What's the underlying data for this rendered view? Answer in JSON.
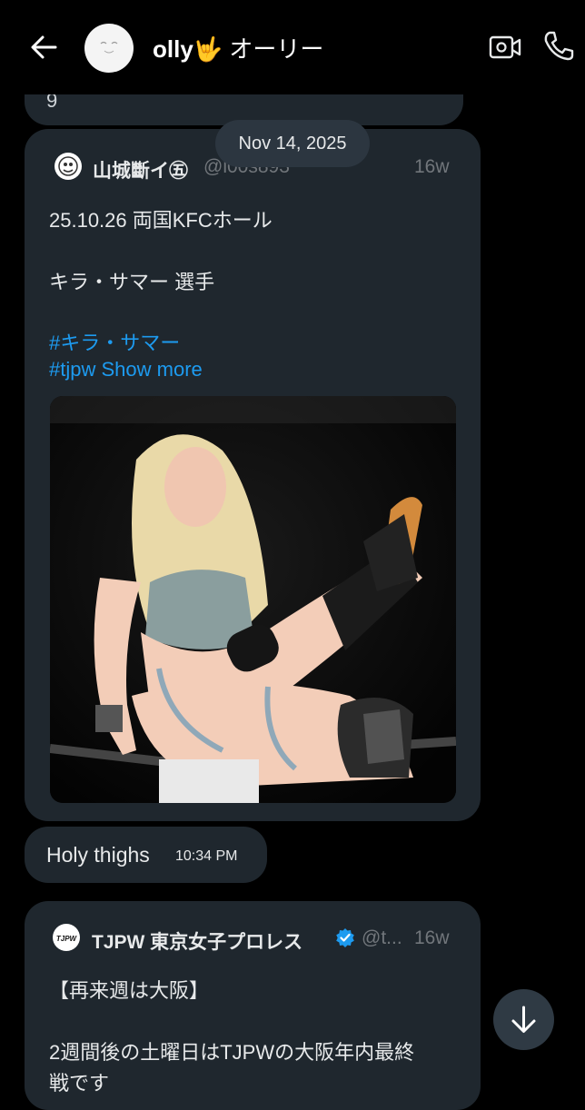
{
  "header": {
    "name": "olly",
    "emoji": "🤟",
    "name_jp": "オーリー"
  },
  "previous_message_fragment": "9",
  "date_separator": "Nov 14, 2025",
  "tweet1": {
    "author": "山城斷イ㊄",
    "handle": "@l00s893",
    "age": "16w",
    "line1": "25.10.26 両国KFCホール",
    "line2": "キラ・サマー 選手",
    "hashtag1": "#キラ・サマー",
    "hashtag2": "#tjpw",
    "show_more": "Show more"
  },
  "message": {
    "text": "Holy thighs",
    "time": "10:34 PM"
  },
  "tweet2": {
    "avatar_text": "TJPW",
    "author": "TJPW 東京女子プロレス",
    "handle": "@t...",
    "age": "16w",
    "line1": "【再来週は大阪】",
    "line2": "2週間後の土曜日はTJPWの大阪年内最終",
    "line3": "戦です"
  },
  "colors": {
    "background": "#000000",
    "bubble": "#1f272e",
    "link": "#1d9bf0",
    "muted": "#71767b"
  }
}
